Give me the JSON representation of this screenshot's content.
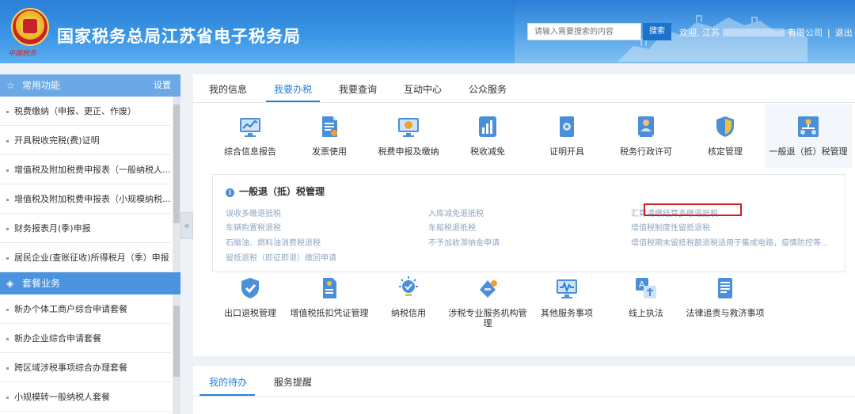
{
  "header": {
    "emblem_text": "中国税务",
    "title": "国家税务总局江苏省电子税务局",
    "search_placeholder": "请输入需要搜索的内容",
    "search_button": "搜索",
    "welcome_prefix": "欢迎, 江苏",
    "company_suffix": "有限公司",
    "logout": "退出",
    "separator": "|"
  },
  "sidebar": {
    "common_title": "常用功能",
    "settings": "设置",
    "common_items": [
      "税费缴纳（申报、更正、作废）",
      "开具税收完税(费)证明",
      "增值税及附加税费申报表（一般纳税人...",
      "增值税及附加税费申报表（小规模纳税...",
      "财务报表月(季)申报",
      "居民企业(查账征收)所得税月（季）申报"
    ],
    "package_title": "套餐业务",
    "package_items": [
      "新办个体工商户综合申请套餐",
      "新办企业综合申请套餐",
      "跨区域涉税事项综合办理套餐",
      "小规模转一般纳税人套餐"
    ],
    "collapse_icon": "«"
  },
  "main": {
    "tabs": [
      "我的信息",
      "我要办税",
      "我要查询",
      "互动中心",
      "公众服务"
    ],
    "active_tab": "我要办税",
    "icons_row1": [
      {
        "label": "综合信息报告",
        "icon": "monitor-chart-icon"
      },
      {
        "label": "发票使用",
        "icon": "invoice-doc-icon"
      },
      {
        "label": "税费申报及缴纳",
        "icon": "monitor-coin-icon"
      },
      {
        "label": "税收减免",
        "icon": "bar-chart-icon"
      },
      {
        "label": "证明开具",
        "icon": "certificate-icon"
      },
      {
        "label": "税务行政许可",
        "icon": "person-card-icon"
      },
      {
        "label": "核定管理",
        "icon": "shield-icon"
      },
      {
        "label": "一般退（抵）税管理",
        "icon": "org-chart-icon"
      }
    ],
    "sub_panel": {
      "title": "一般退（抵）税管理",
      "links": [
        "误收多缴退抵税",
        "入库减免退抵税",
        "汇算清缴结算多缴退抵税",
        "车辆购置税退税",
        "车船税退抵税",
        "增值税制度性留抵退税",
        "石脑油、燃料油消费税退税",
        "不予加收滞纳金申请",
        "增值税期末留抵税额退税适用于集成电路，疫情防控等...",
        "留抵退税（即征即退）缴回申请"
      ],
      "highlighted_link": "汇算清缴结算多缴退抵税"
    },
    "icons_row2": [
      {
        "label": "出口退税管理",
        "icon": "export-shield-icon"
      },
      {
        "label": "增值税抵扣凭证管理",
        "icon": "voucher-icon"
      },
      {
        "label": "纳税信用",
        "icon": "credit-bulb-icon"
      },
      {
        "label": "涉税专业服务机构管理",
        "icon": "service-agency-icon"
      },
      {
        "label": "其他服务事项",
        "icon": "monitor-wave-icon"
      },
      {
        "label": "线上执法",
        "icon": "translate-icon"
      },
      {
        "label": "法律追责与救济事项",
        "icon": "legal-doc-icon"
      }
    ]
  },
  "bottom": {
    "tabs": [
      "我的待办",
      "服务提醒"
    ],
    "active_tab": "我的待办"
  },
  "colors": {
    "header_blue": "#2a7fd6",
    "sidebar_head": "#6aa8e6",
    "link_gray_blue": "#8fa7c2",
    "highlight_red": "#d0201e",
    "icon_blue": "#4b8fd8"
  }
}
